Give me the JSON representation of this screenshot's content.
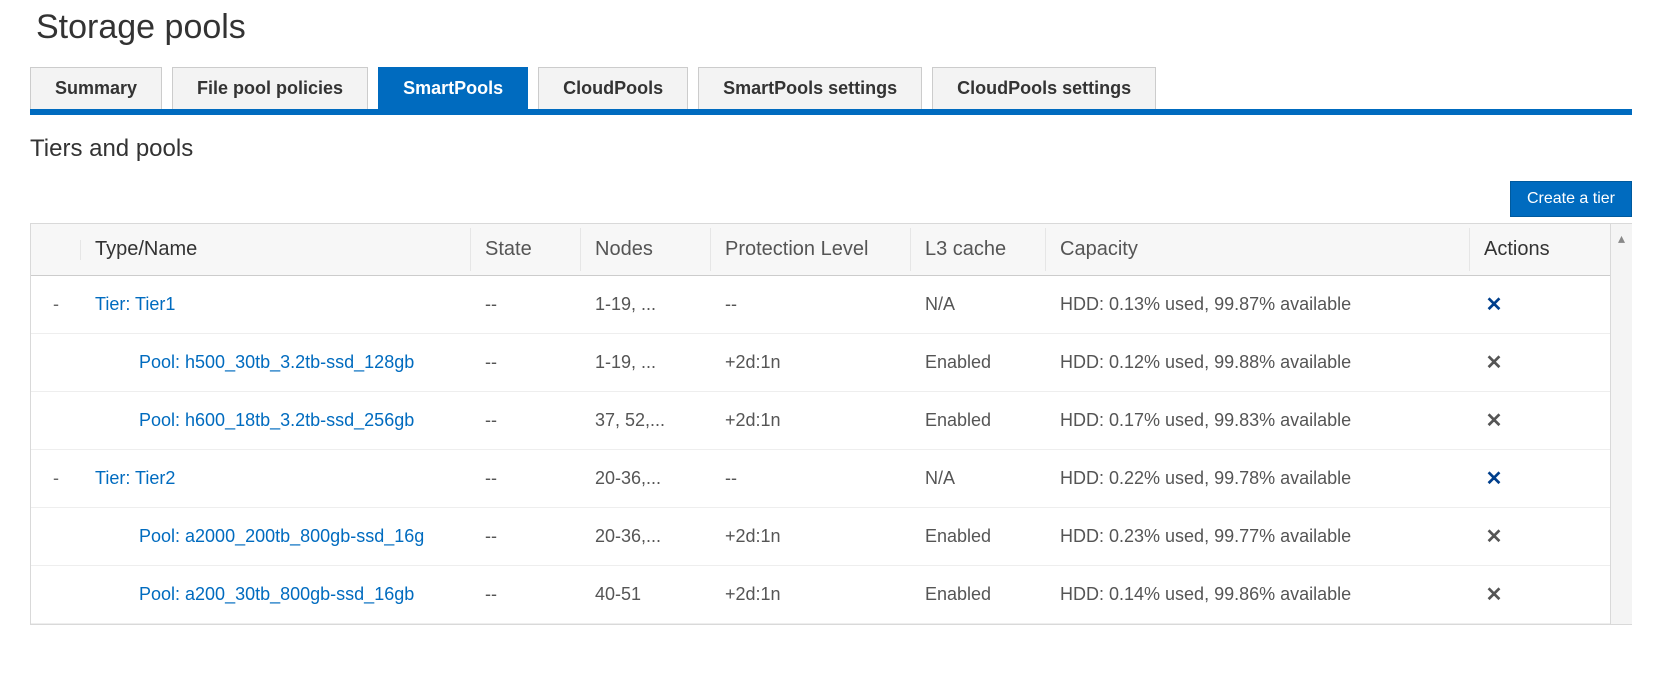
{
  "page": {
    "title": "Storage pools"
  },
  "tabs": {
    "items": [
      {
        "label": "Summary",
        "active": false
      },
      {
        "label": "File pool policies",
        "active": false
      },
      {
        "label": "SmartPools",
        "active": true
      },
      {
        "label": "CloudPools",
        "active": false
      },
      {
        "label": "SmartPools settings",
        "active": false
      },
      {
        "label": "CloudPools settings",
        "active": false
      }
    ]
  },
  "section": {
    "title": "Tiers and pools"
  },
  "toolbar": {
    "create_tier_label": "Create a tier"
  },
  "table": {
    "columns": {
      "type_name": "Type/Name",
      "state": "State",
      "nodes": "Nodes",
      "protection_level": "Protection Level",
      "l3_cache": "L3 cache",
      "capacity": "Capacity",
      "actions": "Actions"
    },
    "rows": [
      {
        "kind": "tier",
        "name": "Tier: Tier1",
        "state": "--",
        "nodes": "1-19, ...",
        "protection": "--",
        "l3": "N/A",
        "capacity": "HDD: 0.13% used, 99.87% available",
        "action_color": "blue"
      },
      {
        "kind": "pool",
        "name": "Pool: h500_30tb_3.2tb-ssd_128gb",
        "state": "--",
        "nodes": "1-19, ...",
        "protection": "+2d:1n",
        "l3": "Enabled",
        "capacity": "HDD: 0.12% used, 99.88% available",
        "action_color": "gray"
      },
      {
        "kind": "pool",
        "name": "Pool: h600_18tb_3.2tb-ssd_256gb",
        "state": "--",
        "nodes": "37, 52,...",
        "protection": "+2d:1n",
        "l3": "Enabled",
        "capacity": "HDD: 0.17% used, 99.83% available",
        "action_color": "gray"
      },
      {
        "kind": "tier",
        "name": "Tier: Tier2",
        "state": "--",
        "nodes": "20-36,...",
        "protection": "--",
        "l3": "N/A",
        "capacity": "HDD: 0.22% used, 99.78% available",
        "action_color": "blue"
      },
      {
        "kind": "pool",
        "name": "Pool: a2000_200tb_800gb-ssd_16g",
        "state": "--",
        "nodes": "20-36,...",
        "protection": "+2d:1n",
        "l3": "Enabled",
        "capacity": "HDD: 0.23% used, 99.77% available",
        "action_color": "gray"
      },
      {
        "kind": "pool",
        "name": "Pool: a200_30tb_800gb-ssd_16gb",
        "state": "--",
        "nodes": "40-51",
        "protection": "+2d:1n",
        "l3": "Enabled",
        "capacity": "HDD: 0.14% used, 99.86% available",
        "action_color": "gray"
      }
    ]
  }
}
